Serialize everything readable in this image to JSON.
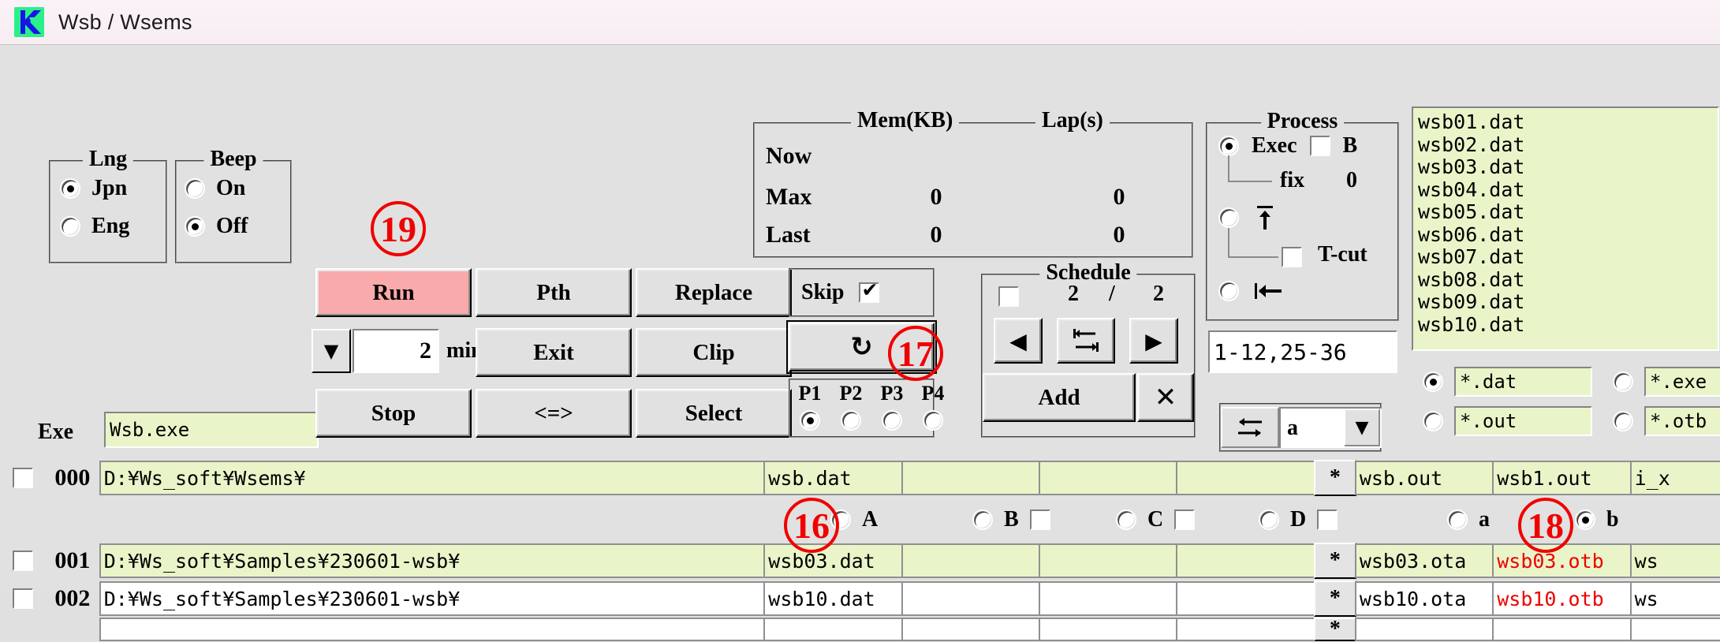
{
  "window": {
    "title": "Wsb / Wsems",
    "icon": "app-logo-icon",
    "titlebar_color": "#faf0f5",
    "client_color": "#e1e1e1"
  },
  "mem_panel": {
    "legend_mem": "Mem(KB)",
    "legend_lap": "Lap(s)",
    "rows": [
      {
        "label": "Now",
        "mem": "",
        "lap": ""
      },
      {
        "label": "Max",
        "mem": "0",
        "lap": "0"
      },
      {
        "label": "Last",
        "mem": "0",
        "lap": "0"
      }
    ]
  },
  "lng_panel": {
    "legend": "Lng",
    "options": [
      {
        "label": "Jpn",
        "selected": true
      },
      {
        "label": "Eng",
        "selected": false
      }
    ]
  },
  "beep_panel": {
    "legend": "Beep",
    "options": [
      {
        "label": "On",
        "selected": false
      },
      {
        "label": "Off",
        "selected": true
      }
    ]
  },
  "exe": {
    "label": "Exe",
    "value": "Wsb.exe"
  },
  "buttons": {
    "run": "Run",
    "pth": "Pth",
    "replace": "Replace",
    "exit": "Exit",
    "clip": "Clip",
    "stop": "Stop",
    "swap": "<=>",
    "select": "Select",
    "refresh_icon": "refresh-icon",
    "add": "Add",
    "delete_icon": "close-x-icon"
  },
  "timer": {
    "value": "2",
    "unit": "min",
    "dropdown_icon": "chevron-down-icon"
  },
  "skip": {
    "label": "Skip",
    "checked": true
  },
  "pgroup": {
    "labels": [
      "P1",
      "P2",
      "P3",
      "P4"
    ],
    "selected_index": 0
  },
  "schedule": {
    "legend": "Schedule",
    "enabled": false,
    "current": "2",
    "separator": "/",
    "total": "2",
    "prev_icon": "triangle-left-icon",
    "swap_icon": "swap-arrows-icon",
    "next_icon": "triangle-right-icon"
  },
  "process": {
    "legend": "Process",
    "exec_label": "Exec",
    "exec_selected": true,
    "b_label": "B",
    "b_checked": false,
    "fix_label": "fix",
    "fix_value": "0",
    "mode2_icon": "arrow-up-to-bar-icon",
    "mode2_selected": false,
    "tcut_label": "T-cut",
    "tcut_checked": false,
    "mode3_icon": "arrow-left-to-bar-icon",
    "mode3_selected": false,
    "range_value": "1-12,25-36"
  },
  "swap_combo": {
    "swap_icon": "swap-updown-arrows-icon",
    "value": "a",
    "dropdown_icon": "chevron-down-icon"
  },
  "file_list": {
    "items": [
      "wsb01.dat",
      "wsb02.dat",
      "wsb03.dat",
      "wsb04.dat",
      "wsb05.dat",
      "wsb06.dat",
      "wsb07.dat",
      "wsb08.dat",
      "wsb09.dat",
      "wsb10.dat"
    ],
    "bg_color": "#e9f5c9"
  },
  "patterns": [
    {
      "value": "*.dat",
      "selected": true
    },
    {
      "value": "*.exe",
      "selected": false
    },
    {
      "value": "*.out",
      "selected": false
    },
    {
      "value": "*.otb",
      "selected": false
    }
  ],
  "abcd_row": {
    "radios": [
      {
        "label": "A",
        "selected": false,
        "has_check": false,
        "checked": false
      },
      {
        "label": "B",
        "selected": false,
        "has_check": true,
        "checked": false
      },
      {
        "label": "C",
        "selected": false,
        "has_check": true,
        "checked": false
      },
      {
        "label": "D",
        "selected": false,
        "has_check": true,
        "checked": false
      }
    ],
    "ab_radios": [
      {
        "label": "a",
        "selected": false
      },
      {
        "label": "b",
        "selected": true
      }
    ]
  },
  "grid": {
    "star_label": "*",
    "rows": [
      {
        "index": "000",
        "checked": false,
        "highlight": true,
        "path": "D:¥Ws_soft¥Wsems¥",
        "in1": "wsb.dat",
        "in2": "",
        "in3": "",
        "in4": "",
        "out1": "wsb.out",
        "out2": "wsb1.out",
        "out3": "i_x",
        "out2_red": false
      },
      {
        "index": "001",
        "checked": false,
        "highlight": true,
        "path": "D:¥Ws_soft¥Samples¥230601-wsb¥",
        "in1": "wsb03.dat",
        "in2": "",
        "in3": "",
        "in4": "",
        "out1": "wsb03.ota",
        "out2": "wsb03.otb",
        "out3": "ws",
        "out2_red": true
      },
      {
        "index": "002",
        "checked": false,
        "highlight": false,
        "path": "D:¥Ws_soft¥Samples¥230601-wsb¥",
        "in1": "wsb10.dat",
        "in2": "",
        "in3": "",
        "in4": "",
        "out1": "wsb10.ota",
        "out2": "wsb10.otb",
        "out3": "ws",
        "out2_red": true
      }
    ]
  },
  "annotations": [
    {
      "label": "16"
    },
    {
      "label": "17"
    },
    {
      "label": "18"
    },
    {
      "label": "19"
    }
  ]
}
